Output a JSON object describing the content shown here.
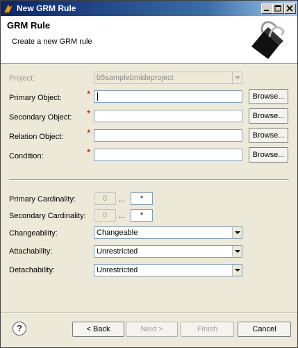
{
  "window": {
    "title": "New GRM Rule"
  },
  "header": {
    "title": "GRM Rule",
    "description": "Create a new GRM rule"
  },
  "form": {
    "project": {
      "label": "Project:",
      "value": "b5samplebmideproject"
    },
    "primary_object": {
      "label": "Primary Object:",
      "value": "",
      "browse": "Browse..."
    },
    "secondary_object": {
      "label": "Secondary Object:",
      "value": "",
      "browse": "Browse..."
    },
    "relation_object": {
      "label": "Relation Object:",
      "value": "",
      "browse": "Browse..."
    },
    "condition": {
      "label": "Condition:",
      "value": "",
      "browse": "Browse..."
    },
    "required_marker": "*",
    "primary_cardinality": {
      "label": "Primary Cardinality:",
      "min": "0",
      "max": "*",
      "separator": "..."
    },
    "secondary_cardinality": {
      "label": "Secondary Cardinality:",
      "min": "0",
      "max": "*",
      "separator": "..."
    },
    "changeability": {
      "label": "Changeability:",
      "value": "Changeable"
    },
    "attachability": {
      "label": "Attachability:",
      "value": "Unrestricted"
    },
    "detachability": {
      "label": "Detachability:",
      "value": "Unrestricted"
    }
  },
  "footer": {
    "help": "?",
    "back": "< Back",
    "next": "Next >",
    "finish": "Finish",
    "cancel": "Cancel"
  }
}
